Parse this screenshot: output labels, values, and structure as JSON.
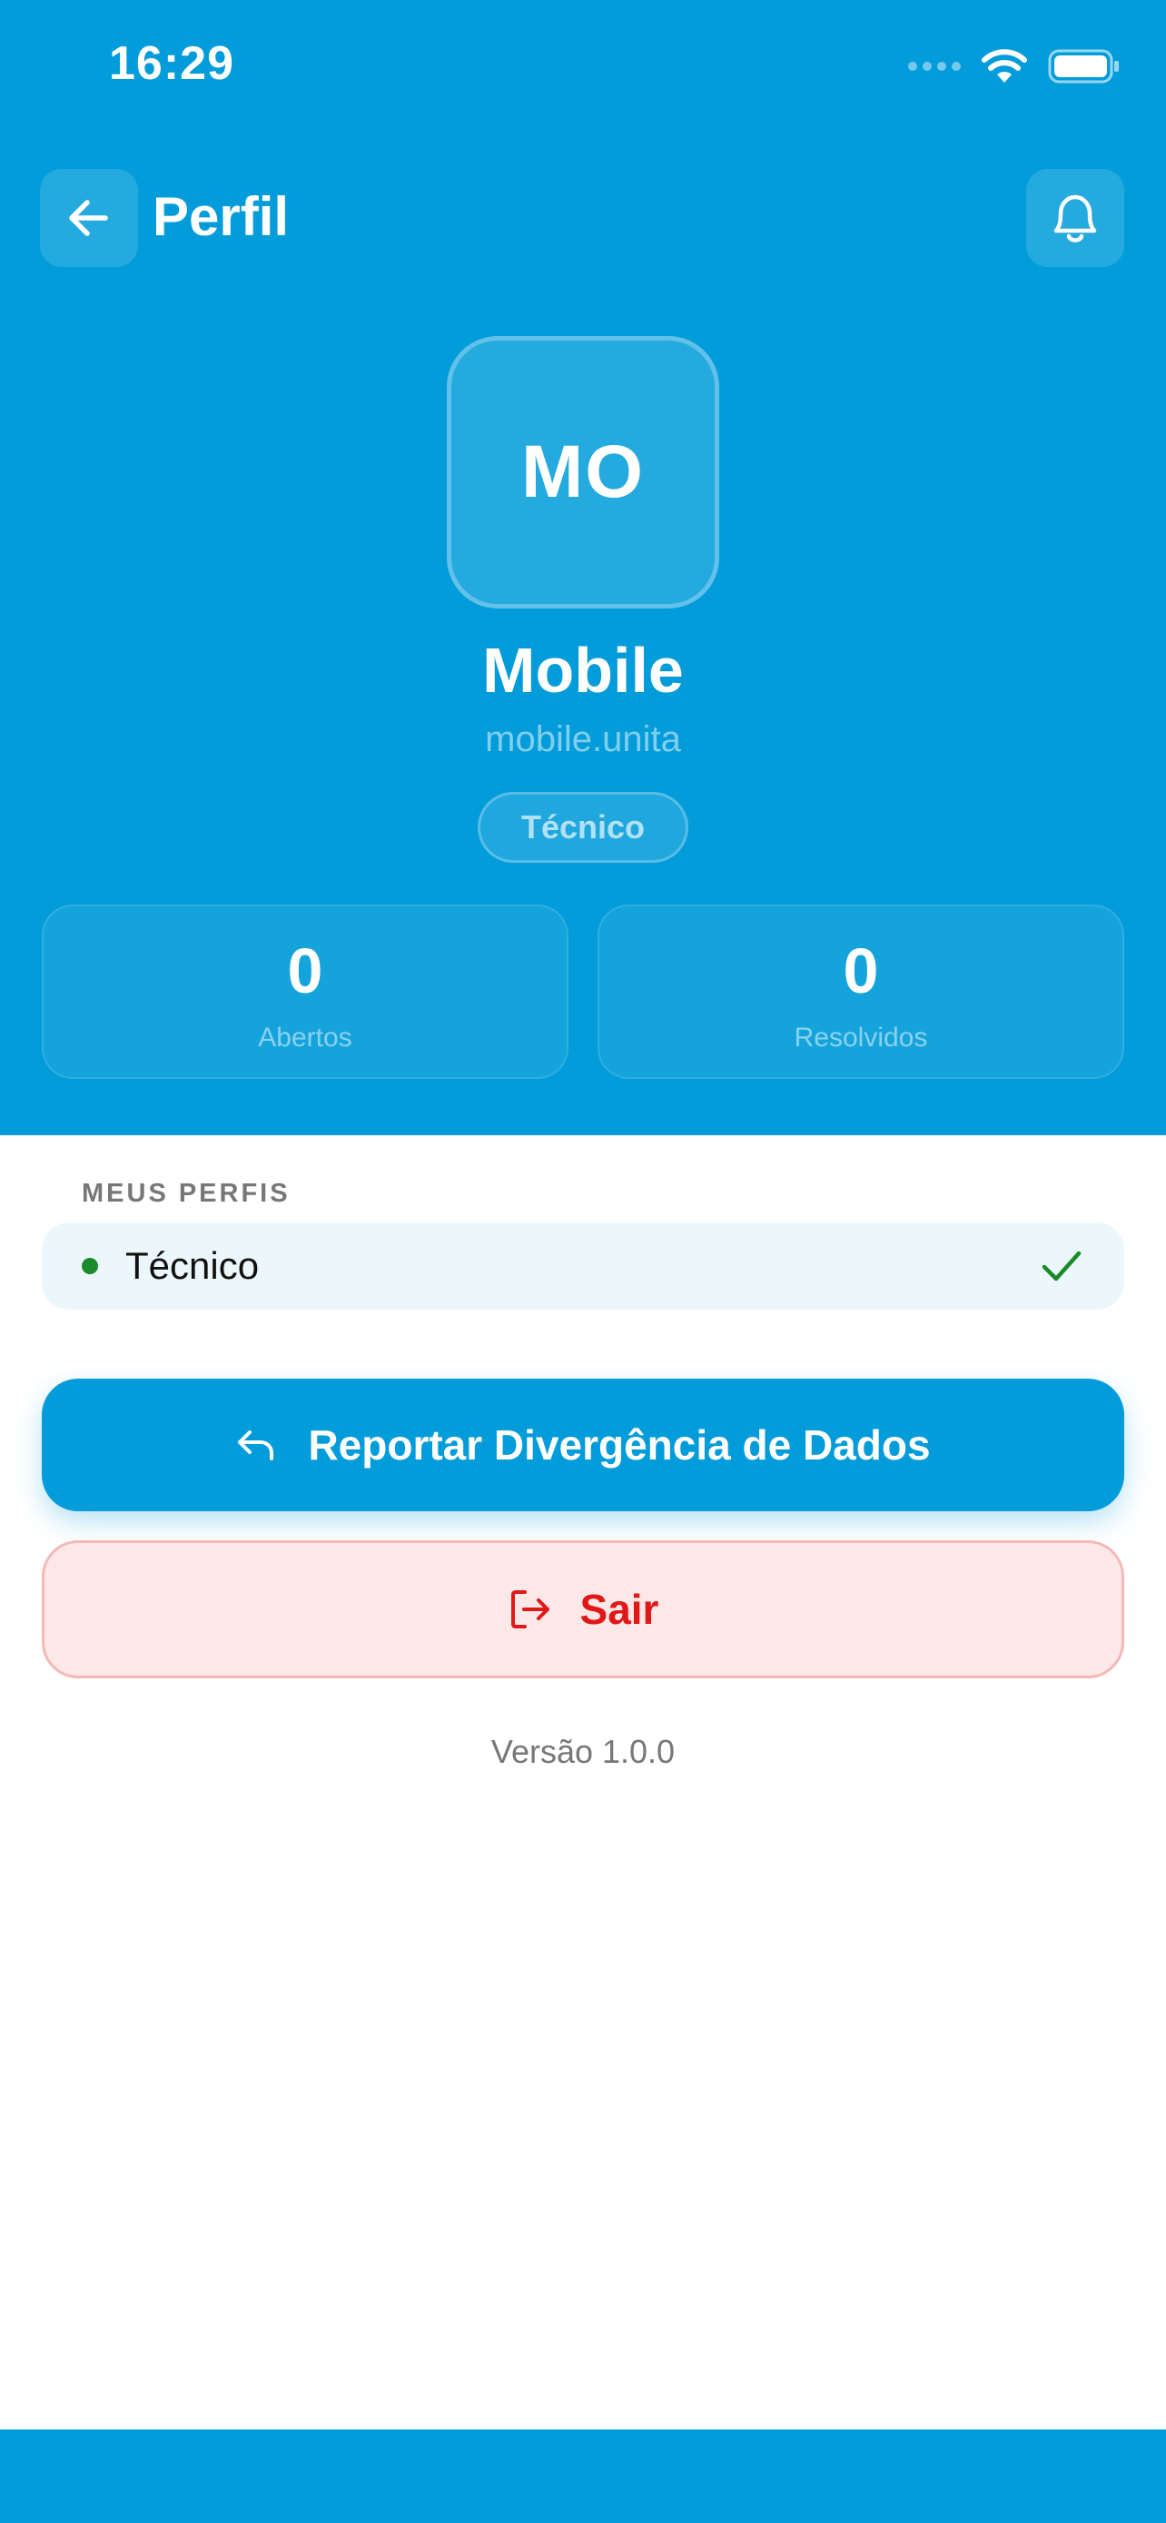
{
  "status_bar": {
    "time": "16:29"
  },
  "header": {
    "title": "Perfil",
    "back_icon": "arrow-left-icon",
    "bell_icon": "bell-icon"
  },
  "profile": {
    "initials": "MO",
    "name": "Mobile",
    "username": "mobile.unita",
    "role": "Técnico"
  },
  "stats": [
    {
      "value": "0",
      "label": "Abertos"
    },
    {
      "value": "0",
      "label": "Resolvidos"
    }
  ],
  "profiles_section": {
    "label": "MEUS PERFIS",
    "items": [
      {
        "label": "Técnico",
        "selected": true
      }
    ]
  },
  "actions": {
    "report_label": "Reportar Divergência de Dados",
    "logout_label": "Sair"
  },
  "footer": {
    "version": "Versão 1.0.0"
  },
  "colors": {
    "primary": "#029cda",
    "logout_text": "#e01818",
    "logout_bg": "#fde8e8",
    "active_dot": "#1a8a2a"
  }
}
